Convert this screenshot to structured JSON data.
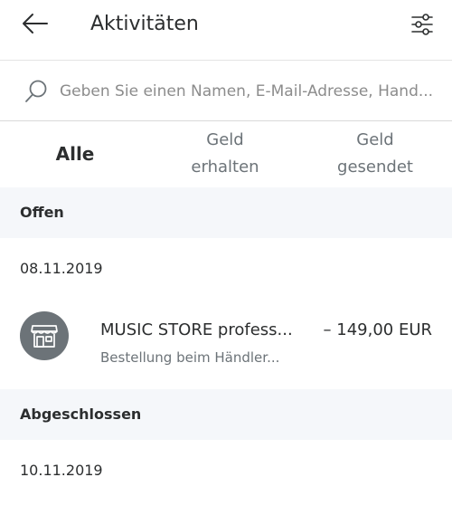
{
  "header": {
    "title": "Aktivitäten",
    "back_icon": "arrow-left-icon",
    "filter_icon": "sliders-icon"
  },
  "search": {
    "placeholder": "Geben Sie einen Namen, E-Mail-Adresse, Hand..."
  },
  "tabs": [
    {
      "line1": "Alle",
      "line2": ""
    },
    {
      "line1": "Geld",
      "line2": "erhalten"
    },
    {
      "line1": "Geld",
      "line2": "gesendet"
    }
  ],
  "sections": [
    {
      "title": "Offen",
      "date": "08.11.2019",
      "transaction": {
        "merchant": "MUSIC STORE profess...",
        "subtitle": "Bestellung beim Händler...",
        "amount": "– 149,00 EUR",
        "icon": "storefront-icon"
      }
    },
    {
      "title": "Abgeschlossen",
      "date": "10.11.2019"
    }
  ],
  "colors": {
    "section_bg": "#f5f7fa",
    "avatar_bg": "#6c7378",
    "text_primary": "#2c2e2f",
    "text_secondary": "#6c7378"
  }
}
